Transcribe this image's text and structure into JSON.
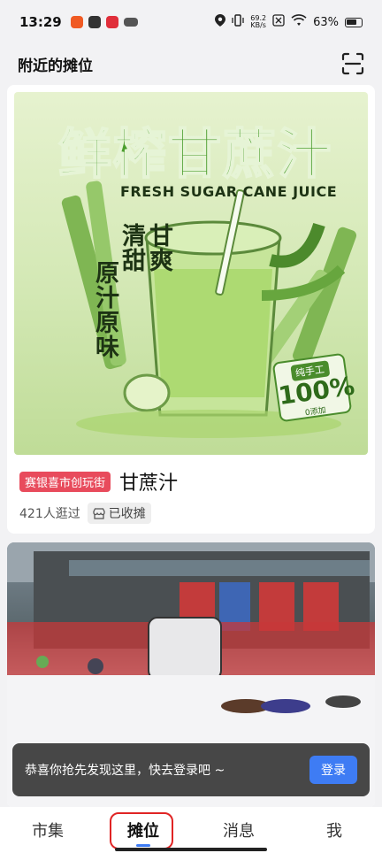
{
  "status_bar": {
    "time": "13:29",
    "net_speed_value": "69.2",
    "net_speed_unit": "KB/s",
    "signal": "4G",
    "battery": "63%"
  },
  "header": {
    "title": "附近的摊位"
  },
  "stall_card": {
    "poster": {
      "title": "鲜榨甘蔗汁",
      "subtitle": "FRESH SUGAR CANE JUICE",
      "line1": "清甜",
      "line2": "甘爽",
      "line3": "原汁原味",
      "line4": "",
      "badge_top": "纯手工",
      "badge_mid": "100%",
      "badge_bot": "0添加"
    },
    "district_tag": "赛银喜市创玩街",
    "name": "甘蔗汁",
    "visitors": "421人逛过",
    "status": "已收摊"
  },
  "toast": {
    "text": "恭喜你抢先发现这里，快去登录吧 ~",
    "button": "登录"
  },
  "tabbar": {
    "tabs": [
      "市集",
      "摊位",
      "消息",
      "我"
    ]
  }
}
